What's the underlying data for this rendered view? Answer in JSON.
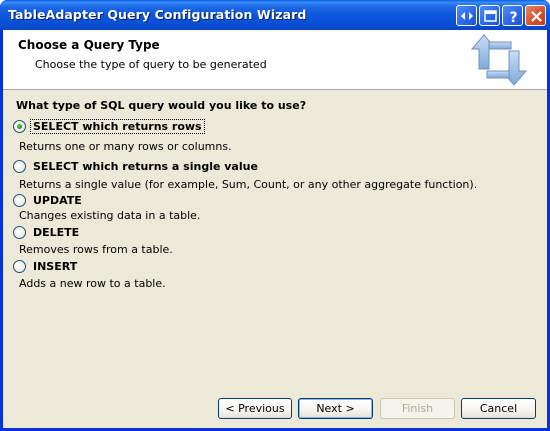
{
  "window": {
    "title": "TableAdapter Query Configuration Wizard"
  },
  "title_buttons": {
    "help_icon": "help-icon",
    "minimize_icon": "minimize-icon",
    "maximize_icon": "maximize-icon",
    "close_icon": "close-icon",
    "resize_icon": "resize-icon"
  },
  "header": {
    "title": "Choose a Query Type",
    "subtitle": "Choose the type of query to be generated",
    "icon": "query-arrows-icon"
  },
  "question": "What type of SQL query would you like to use?",
  "options": [
    {
      "label": "SELECT which returns rows",
      "description": "Returns one or many rows or columns.",
      "checked": true
    },
    {
      "label": "SELECT which returns a single value",
      "description": "Returns a single value (for example, Sum, Count, or any other aggregate function).",
      "checked": false
    },
    {
      "label": "UPDATE",
      "description": "Changes existing data in a table.",
      "checked": false
    },
    {
      "label": "DELETE",
      "description": "Removes rows from a table.",
      "checked": false
    },
    {
      "label": "INSERT",
      "description": "Adds a new row to a table.",
      "checked": false
    }
  ],
  "buttons": {
    "previous": "< Previous",
    "next": "Next >",
    "finish": "Finish",
    "cancel": "Cancel"
  },
  "colors": {
    "titlebar": "#0a55dc",
    "client": "#ece9d8",
    "header_bg": "#ffffff",
    "radio_check": "#21a121"
  }
}
